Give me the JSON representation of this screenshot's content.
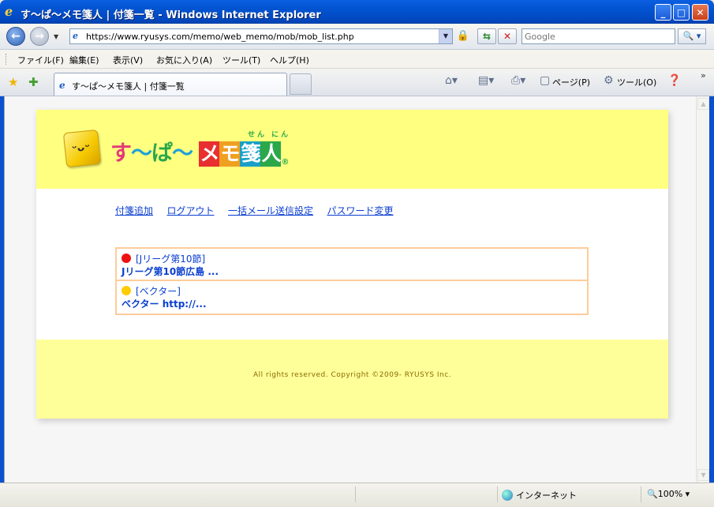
{
  "window": {
    "title": "す〜ぱ〜メモ箋人 | 付箋一覧 - Windows Internet Explorer",
    "minimize": "_",
    "maximize": "□",
    "close": "✕"
  },
  "address": {
    "url": "https://www.ryusys.com/memo/web_memo/mob/mob_list.php",
    "search_placeholder": "Google"
  },
  "menu": [
    "ファイル(F)",
    "編集(E)",
    "表示(V)",
    "お気に入り(A)",
    "ツール(T)",
    "ヘルプ(H)"
  ],
  "tab": {
    "label": "す〜ぱ〜メモ箋人 | 付箋一覧"
  },
  "commands": {
    "page": "ページ(P)",
    "tools": "ツール(O)"
  },
  "logo": {
    "part1": "す",
    "part2": "〜",
    "part3": "ぱ",
    "part4": "〜",
    "box1": "メ",
    "box2": "モ",
    "box3": "箋",
    "box4": "人",
    "ruby": "せん にん",
    "reg": "®"
  },
  "nav": [
    "付箋追加",
    "ログアウト",
    "一括メール送信設定",
    "パスワード変更"
  ],
  "memos": [
    {
      "category": "[Jリーグ第10節]",
      "text": "Jリーグ第10節広島 ...",
      "color": "#ee1111"
    },
    {
      "category": "[ベクター]",
      "text": "ベクター http://...",
      "color": "#ffcc00"
    }
  ],
  "footer": {
    "copyright": "All rights reserved. Copyright ©2009- RYUSYS Inc."
  },
  "status": {
    "zone": "インターネット",
    "zoom": "100%"
  },
  "colors": {
    "header_bg": "#ffff80",
    "footer_bg": "#ffff99",
    "link": "#0a3fd0",
    "border": "#ffcc99"
  }
}
